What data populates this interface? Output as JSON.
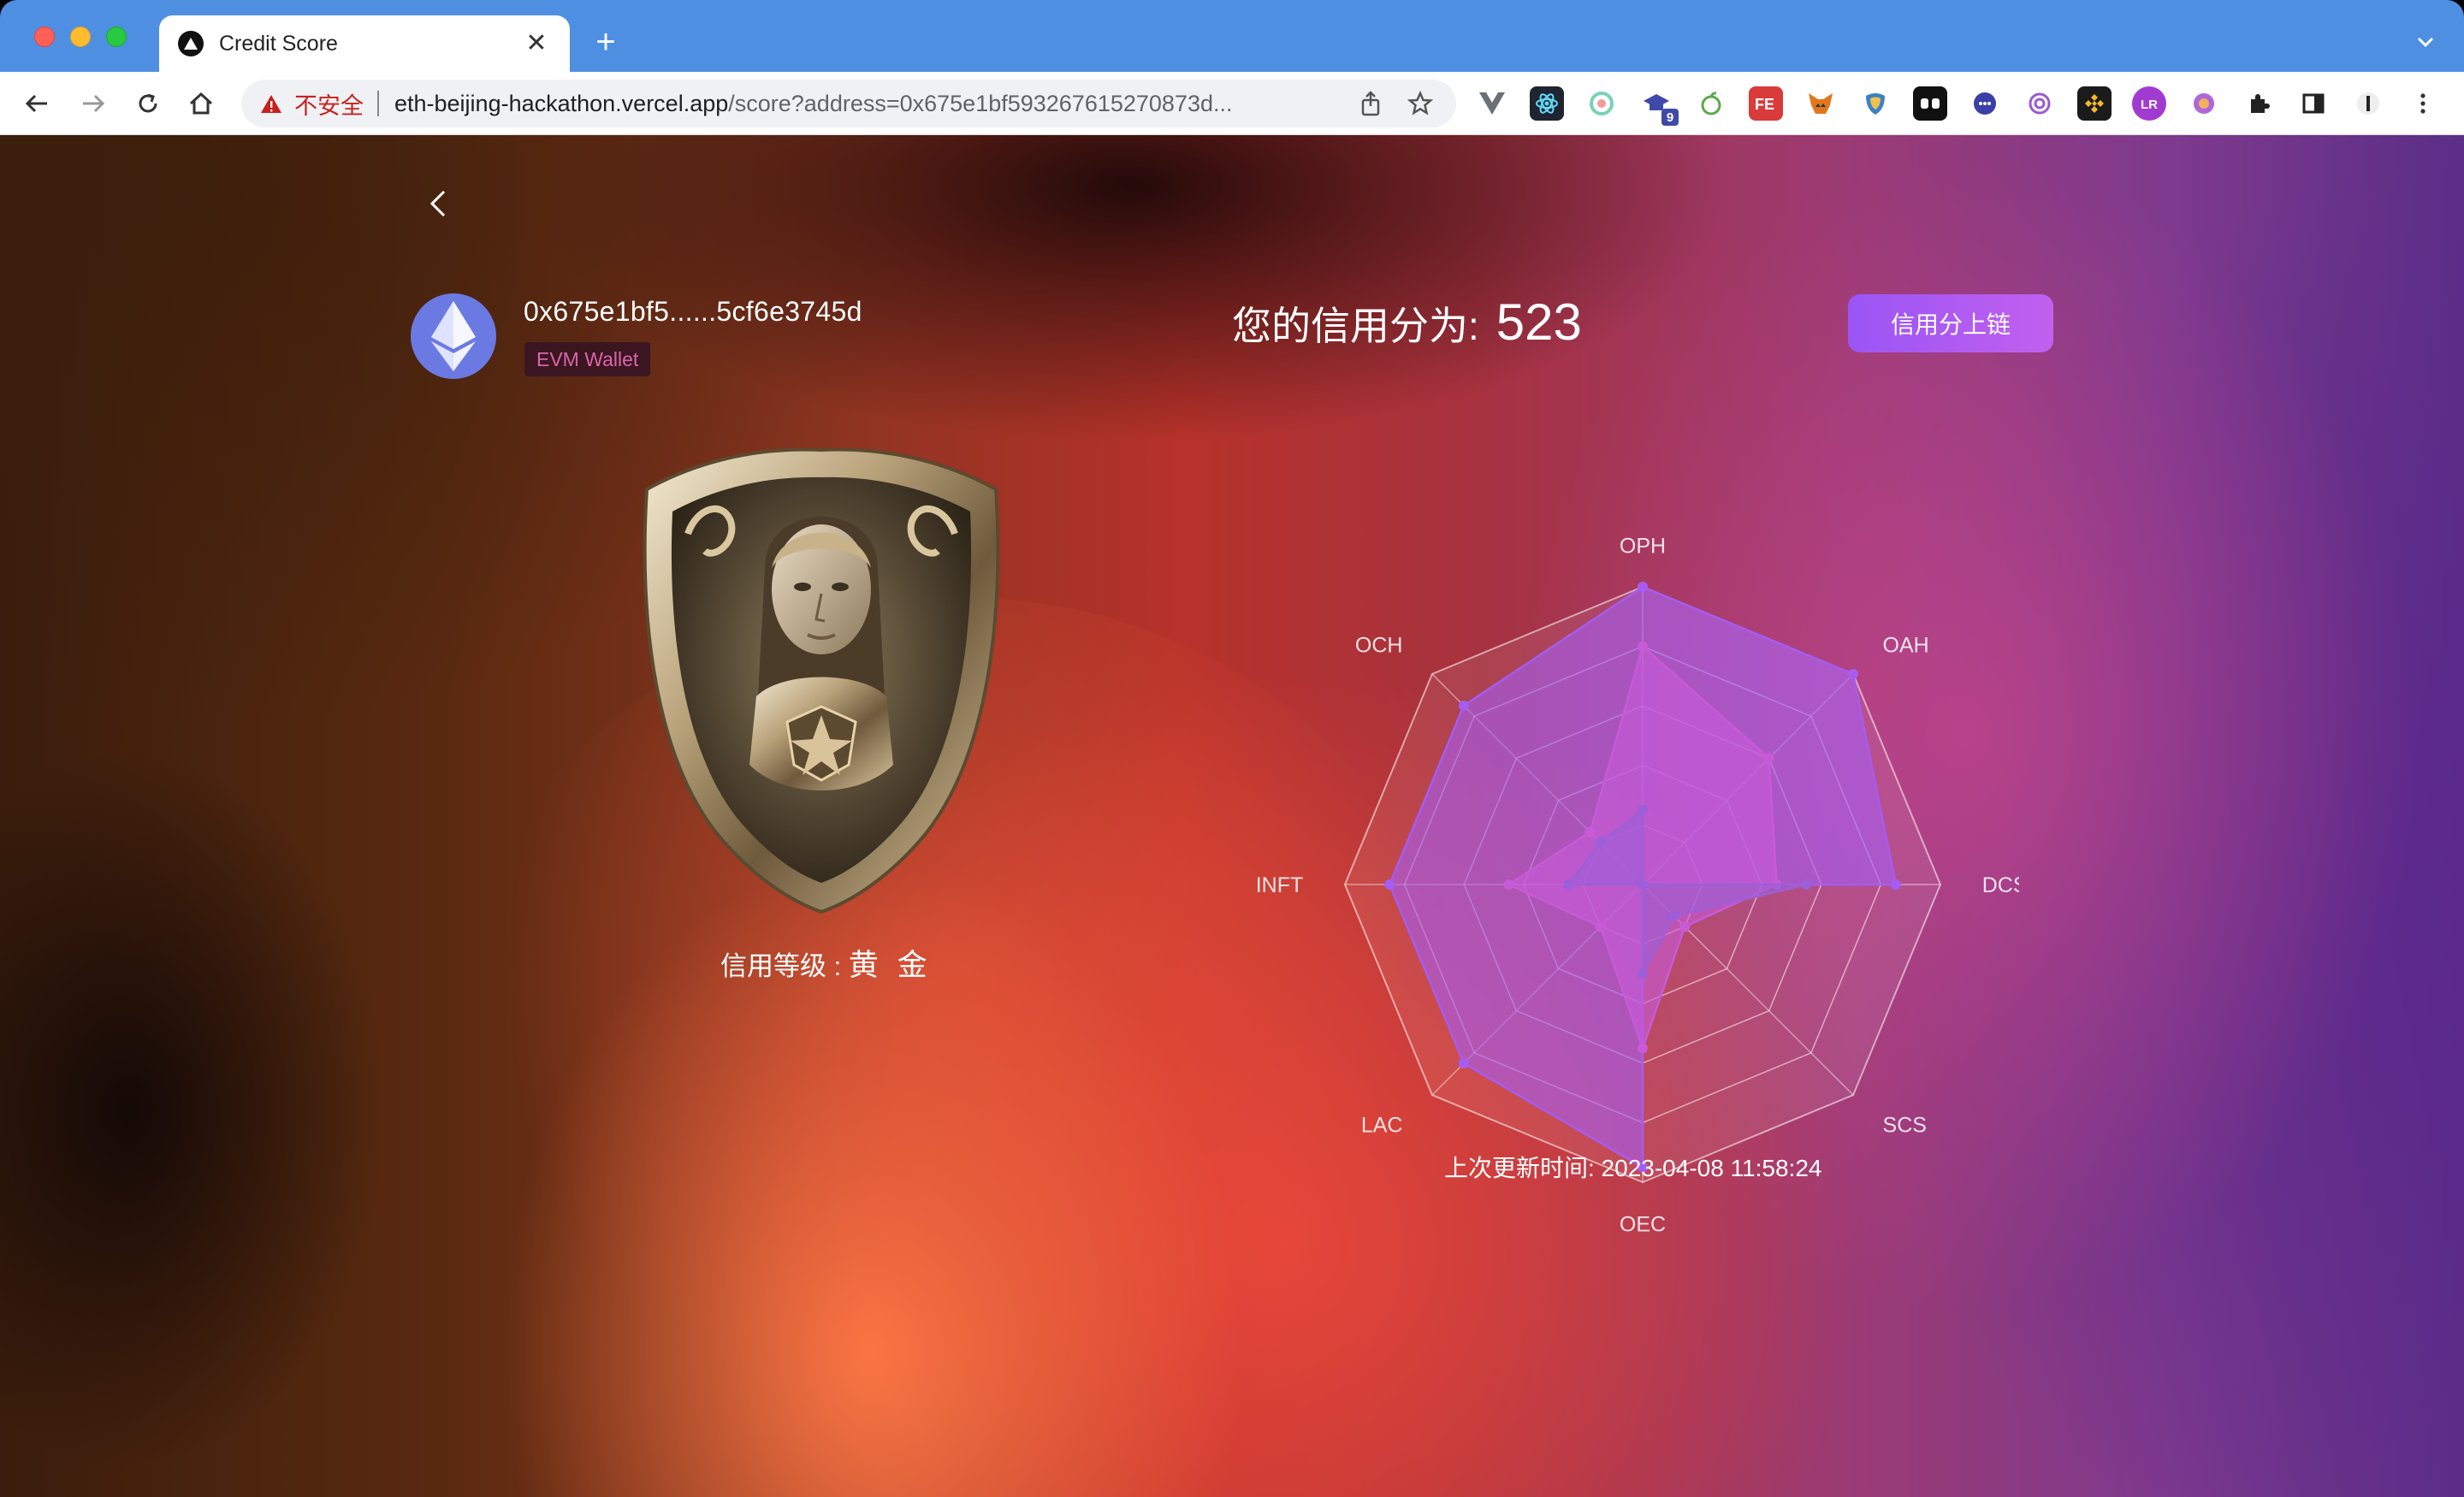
{
  "browser": {
    "tab_title": "Credit Score",
    "insecure_label": "不安全",
    "url_host": "eth-beijing-hackathon.vercel.app",
    "url_path": "/score?address=0x675e1bf593267615270873d...",
    "extension_badge": "9"
  },
  "profile": {
    "address": "0x675e1bf5......5cf6e3745d",
    "wallet_type": "EVM Wallet"
  },
  "level": {
    "label": "信用等级 : ",
    "value": "黄 金"
  },
  "score": {
    "label": "您的信用分为:",
    "value": "523",
    "chain_button": "信用分上链"
  },
  "chart_data": {
    "type": "radar",
    "axes": [
      "OPH",
      "OAH",
      "DCS",
      "SCS",
      "OEC",
      "LAC",
      "INFT",
      "OCH"
    ],
    "max": 1.0,
    "rings": 5,
    "series": [
      {
        "values": [
          1.0,
          1.0,
          0.85,
          0.0,
          0.95,
          0.85,
          0.85,
          0.85
        ],
        "color": "#a65cf0"
      },
      {
        "values": [
          0.8,
          0.6,
          0.45,
          0.2,
          0.55,
          0.2,
          0.45,
          0.25
        ],
        "color": "#c85ad8"
      },
      {
        "values": [
          0.25,
          0.0,
          0.55,
          0.15,
          0.3,
          0.0,
          0.25,
          0.2
        ],
        "color": "#9d5fd9"
      }
    ]
  },
  "updated": {
    "text": "上次更新时间: 2023-04-08 11:58:24"
  }
}
